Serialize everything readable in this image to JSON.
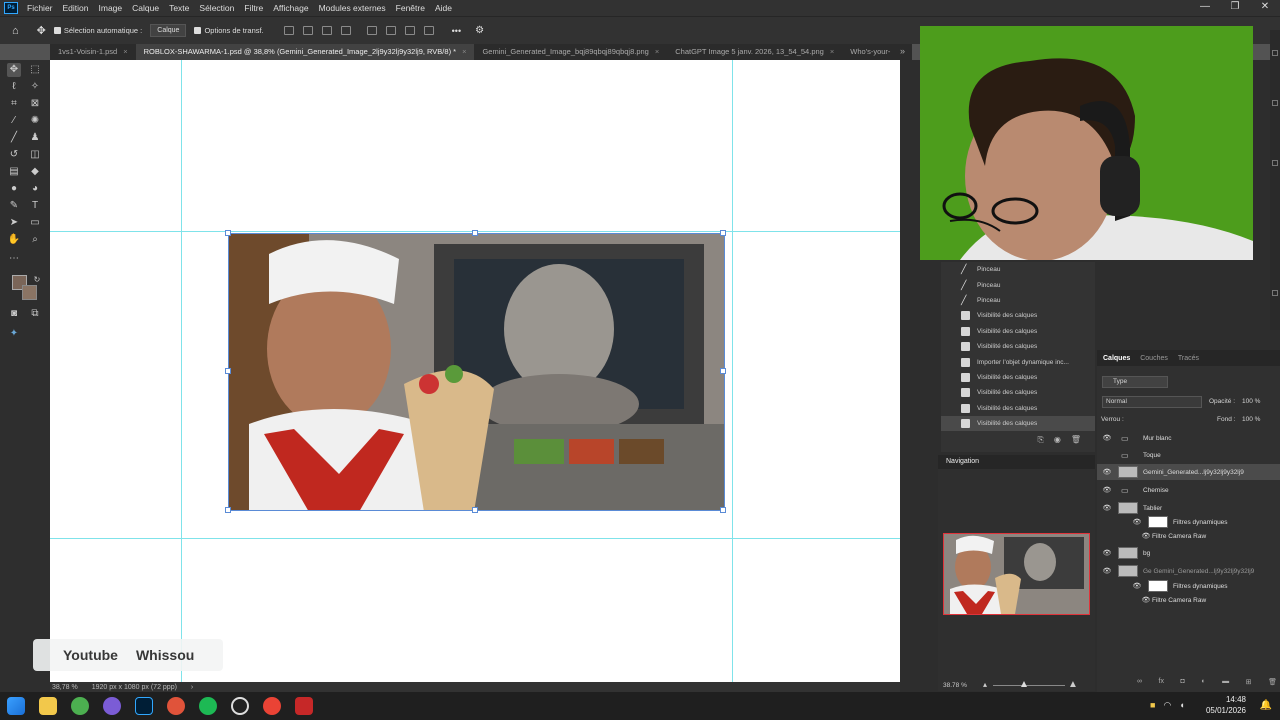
{
  "app": {
    "logo": "Ps"
  },
  "menu": [
    "Fichier",
    "Edition",
    "Image",
    "Calque",
    "Texte",
    "Sélection",
    "Filtre",
    "Affichage",
    "Modules externes",
    "Fenêtre",
    "Aide"
  ],
  "window_controls": {
    "min": "—",
    "max": "❐",
    "close": "✕"
  },
  "options": {
    "auto_select_label": "Sélection automatique :",
    "auto_select_value": "Calque",
    "transform_label": "Options de transf.",
    "more": "•••"
  },
  "tabs": [
    {
      "label": "1vs1-Voisin-1.psd",
      "active": false
    },
    {
      "label": "ROBLOX-SHAWARMA-1.psd @ 38,8% (Gemini_Generated_Image_2lj9y32lj9y32lj9, RVB/8) *",
      "active": true
    },
    {
      "label": "Gemini_Generated_Image_bqj89qbqj89qbqj8.png",
      "active": false
    },
    {
      "label": "ChatGPT Image 5 janv. 2026, 13_54_54.png",
      "active": false
    },
    {
      "label": "Who's-your-",
      "active": false
    }
  ],
  "tabs_overflow": "»",
  "canvas": {
    "watermark_1": "Youtube",
    "watermark_2": "Whissou"
  },
  "status": {
    "zoom": "38,78 %",
    "doc_info": "1920 px x 1080 px (72 ppp)",
    "arrow": "›"
  },
  "history": {
    "items": [
      "Pinceau",
      "Pinceau",
      "Pinceau",
      "Visibilité des calques",
      "Visibilité des calques",
      "Visibilité des calques",
      "Importer l'objet dynamique inc...",
      "Visibilité des calques",
      "Visibilité des calques",
      "Visibilité des calques",
      "Visibilité des calques"
    ]
  },
  "navigation": {
    "title": "Navigation",
    "zoom": "38.78 %"
  },
  "layers_panel": {
    "tabs": [
      "Calques",
      "Couches",
      "Tracés"
    ],
    "filter": "Type",
    "blend_mode": "Normal",
    "opacity_label": "Opacité :",
    "opacity_value": "100 %",
    "lock_label": "Verrou :",
    "fill_label": "Fond :",
    "fill_value": "100 %",
    "layers": [
      {
        "name": "Mur blanc",
        "kind": "folder"
      },
      {
        "name": "Toque",
        "kind": "folder"
      },
      {
        "name": "Gemini_Generated...lj9y32lj9y32lj9",
        "kind": "smart"
      },
      {
        "name": "Chemise",
        "kind": "folder"
      },
      {
        "name": "Tablier",
        "kind": "smart"
      },
      {
        "name": "Filtres dynamiques",
        "kind": "filter"
      },
      {
        "name": "Filtre Camera Raw",
        "kind": "subfilter"
      },
      {
        "name": "bg",
        "kind": "smart"
      },
      {
        "name": "Ge Gemini_Generated...lj9y32lj9y32lj9",
        "kind": "smart"
      },
      {
        "name": "Filtres dynamiques",
        "kind": "filter"
      },
      {
        "name": "Filtre Camera Raw",
        "kind": "subfilter"
      }
    ]
  },
  "clock": {
    "time": "14:48",
    "date": "05/01/2026"
  },
  "colors": {
    "accent": "#31a8ff",
    "guide": "#7fe3ea",
    "green_screen": "#4d9d1c",
    "nav_frame": "#e0333a"
  }
}
